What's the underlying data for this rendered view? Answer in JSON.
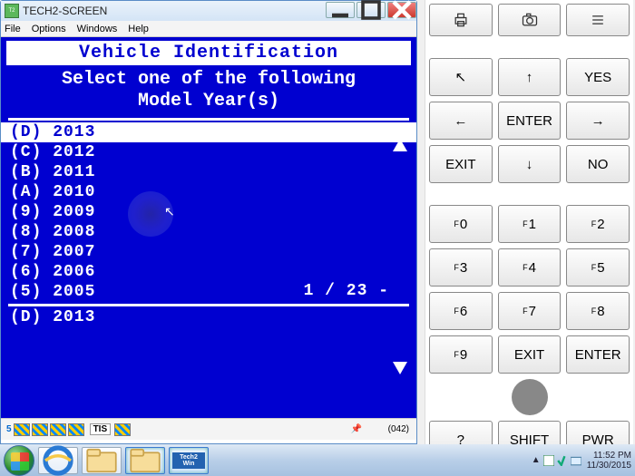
{
  "window": {
    "title": "TECH2-SCREEN"
  },
  "menubar": [
    "File",
    "Options",
    "Windows",
    "Help"
  ],
  "screen": {
    "header": "Vehicle Identification",
    "subheader_line1": "Select one of the following",
    "subheader_line2": "Model Year(s)",
    "list": [
      {
        "code": "(D)",
        "label": "2013",
        "selected": true
      },
      {
        "code": "(C)",
        "label": "2012",
        "selected": false
      },
      {
        "code": "(B)",
        "label": "2011",
        "selected": false
      },
      {
        "code": "(A)",
        "label": "2010",
        "selected": false
      },
      {
        "code": "(9)",
        "label": "2009",
        "selected": false
      },
      {
        "code": "(8)",
        "label": "2008",
        "selected": false
      },
      {
        "code": "(7)",
        "label": "2007",
        "selected": false
      },
      {
        "code": "(6)",
        "label": "2006",
        "selected": false
      },
      {
        "code": "(5)",
        "label": "2005",
        "selected": false
      }
    ],
    "pager": "1 / 23 -",
    "footer_selected": "(D) 2013"
  },
  "statusbar": {
    "count": "(042)"
  },
  "keypad": {
    "row_icons": [
      "print-icon",
      "camera-icon",
      "list-icon"
    ],
    "nav": {
      "up": "↑",
      "down": "↓",
      "left": "←",
      "right": "→",
      "diag": "↖",
      "enter": "ENTER",
      "yes": "YES",
      "no": "NO",
      "exit": "EXIT"
    },
    "fkeys": [
      "0",
      "1",
      "2",
      "3",
      "4",
      "5",
      "6",
      "7",
      "8",
      "9"
    ],
    "fexit": "EXIT",
    "fenter": "ENTER",
    "bottom": {
      "q": "?",
      "shift": "SHIFT",
      "pwr": "PWR"
    }
  },
  "taskbar": {
    "app_label": "Tech2 Win",
    "clock_time": "11:52 PM",
    "clock_date": "11/30/2015"
  }
}
